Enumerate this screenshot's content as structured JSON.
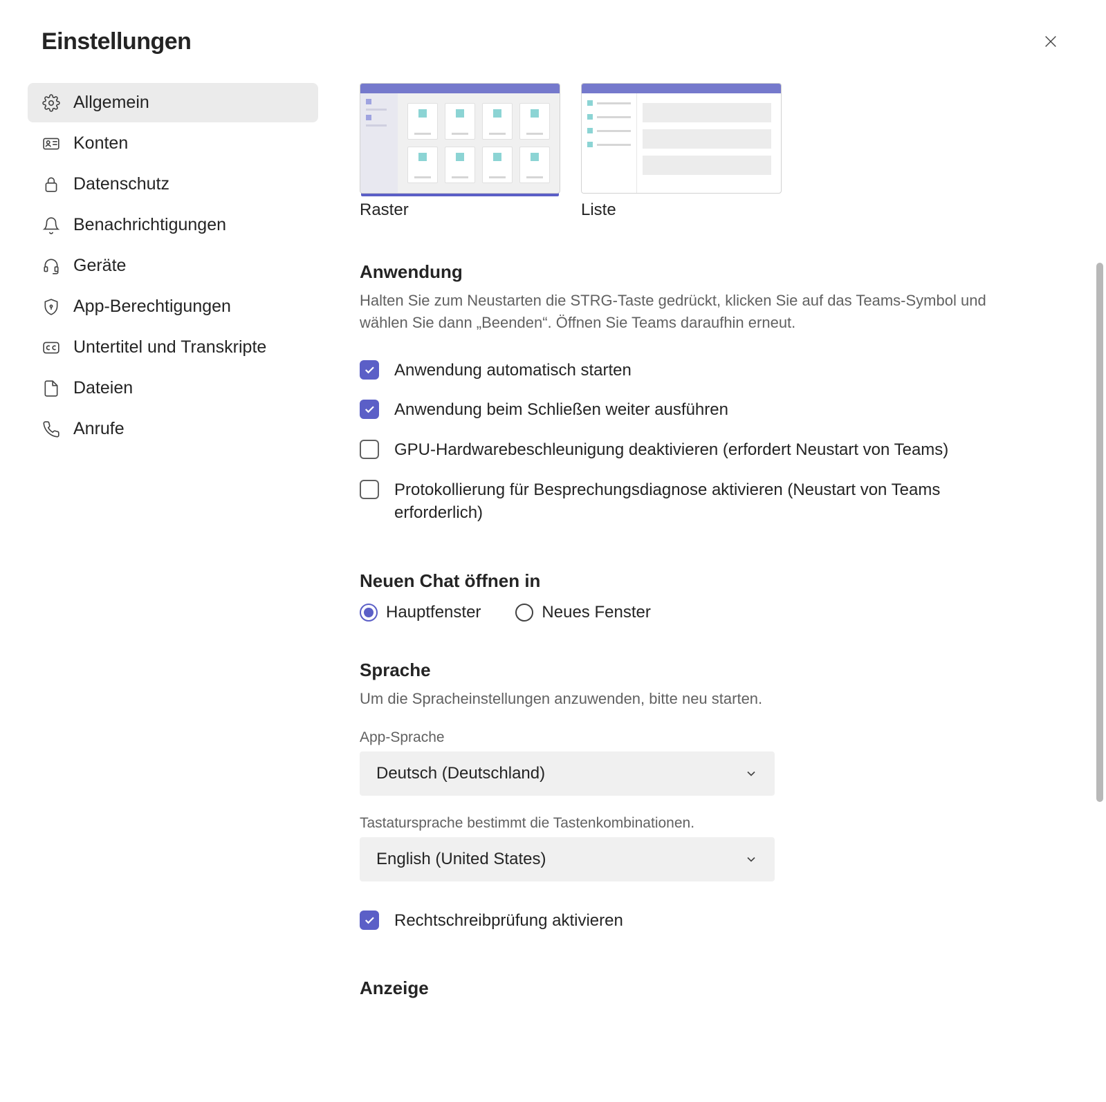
{
  "header": {
    "title": "Einstellungen"
  },
  "sidebar": {
    "items": [
      {
        "label": "Allgemein"
      },
      {
        "label": "Konten"
      },
      {
        "label": "Datenschutz"
      },
      {
        "label": "Benachrichtigungen"
      },
      {
        "label": "Geräte"
      },
      {
        "label": "App-Berechtigungen"
      },
      {
        "label": "Untertitel und Transkripte"
      },
      {
        "label": "Dateien"
      },
      {
        "label": "Anrufe"
      }
    ]
  },
  "layout": {
    "grid_label": "Raster",
    "list_label": "Liste"
  },
  "app_section": {
    "title": "Anwendung",
    "desc": "Halten Sie zum Neustarten die STRG-Taste gedrückt, klicken Sie auf das Teams-Symbol und wählen Sie dann „Beenden“. Öffnen Sie Teams daraufhin erneut.",
    "checks": [
      "Anwendung automatisch starten",
      "Anwendung beim Schließen weiter ausführen",
      "GPU-Hardwarebeschleunigung deaktivieren (erfordert Neustart von Teams)",
      "Protokollierung für Besprechungsdiagnose aktivieren (Neustart von Teams erforderlich)"
    ]
  },
  "chat_section": {
    "title": "Neuen Chat öffnen in",
    "option_main": "Hauptfenster",
    "option_new": "Neues Fenster"
  },
  "lang_section": {
    "title": "Sprache",
    "desc": "Um die Spracheinstellungen anzuwenden, bitte neu starten.",
    "app_lang_label": "App-Sprache",
    "app_lang_value": "Deutsch (Deutschland)",
    "kb_lang_label": "Tastatursprache bestimmt die Tastenkombinationen.",
    "kb_lang_value": "English (United States)",
    "spellcheck_label": "Rechtschreibprüfung aktivieren"
  },
  "display_section": {
    "title": "Anzeige"
  }
}
